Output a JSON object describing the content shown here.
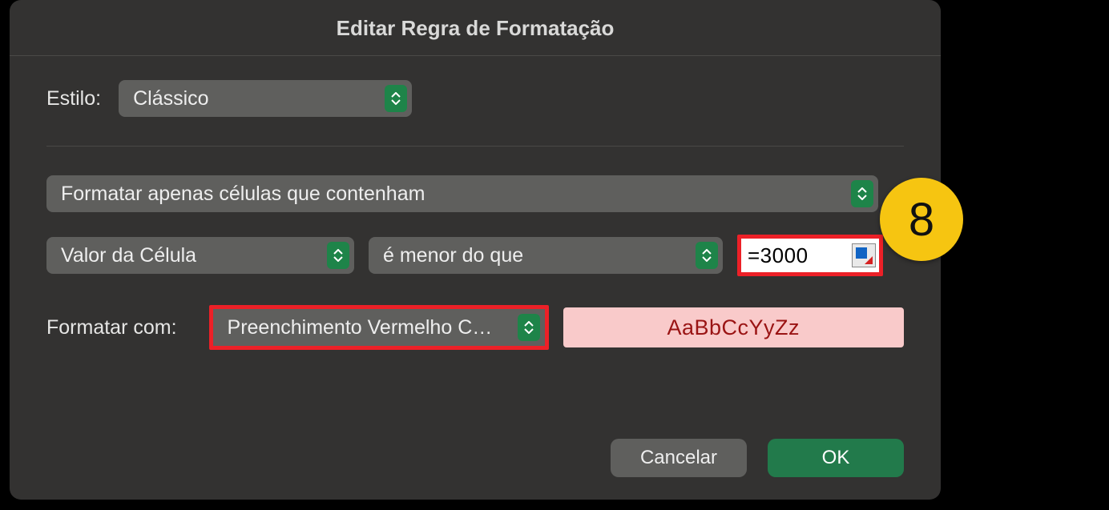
{
  "dialog": {
    "title": "Editar Regra de Formatação"
  },
  "style_row": {
    "label": "Estilo:",
    "value": "Clássico"
  },
  "rule_type": "Formatar apenas células que contenham",
  "condition": {
    "basis": "Valor da Célula",
    "operator": "é menor do que",
    "value": "=3000"
  },
  "format_with": {
    "label": "Formatar com:",
    "preset": "Preenchimento Vermelho C…",
    "preview_text": "AaBbCcYyZz"
  },
  "buttons": {
    "cancel": "Cancelar",
    "ok": "OK"
  },
  "annotation": {
    "badge_number": "8"
  }
}
